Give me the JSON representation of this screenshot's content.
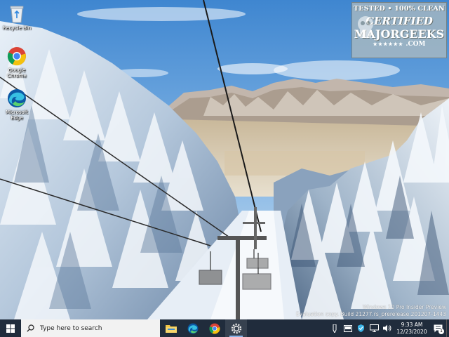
{
  "desktop": {
    "icons": [
      {
        "label": "Recycle Bin",
        "icon": "recycle-bin-icon"
      },
      {
        "label": "Google Chrome",
        "icon": "chrome-icon"
      },
      {
        "label": "Microsoft Edge",
        "icon": "edge-icon"
      }
    ],
    "watermark": {
      "line1": "TESTED • 100% CLEAN",
      "line2": "CERTIFIED",
      "line3": "MAJORGEEKS",
      "stars": "★★★★★★",
      "domain": ".COM"
    },
    "build_info": {
      "line1": "Windows 10 Pro Insider Preview",
      "line2": "Evaluation copy. Build 21277.rs_prerelease.201207-1443"
    }
  },
  "taskbar": {
    "search_placeholder": "Type here to search",
    "pinned_apps": [
      "file-explorer-icon",
      "edge-icon",
      "chrome-icon",
      "settings-icon"
    ],
    "active_app": "settings-icon",
    "tray_icons": [
      "pen-workspace-icon",
      "taskbar-app-icon",
      "security-icon",
      "network-icon",
      "volume-icon"
    ],
    "clock": {
      "time": "9:33 AM",
      "date": "12/23/2020"
    },
    "notification_count": "1"
  },
  "colors": {
    "taskbar_bg": "#202c3c",
    "sky": "#5b9bd8",
    "search_bg": "#f2f2f2"
  }
}
